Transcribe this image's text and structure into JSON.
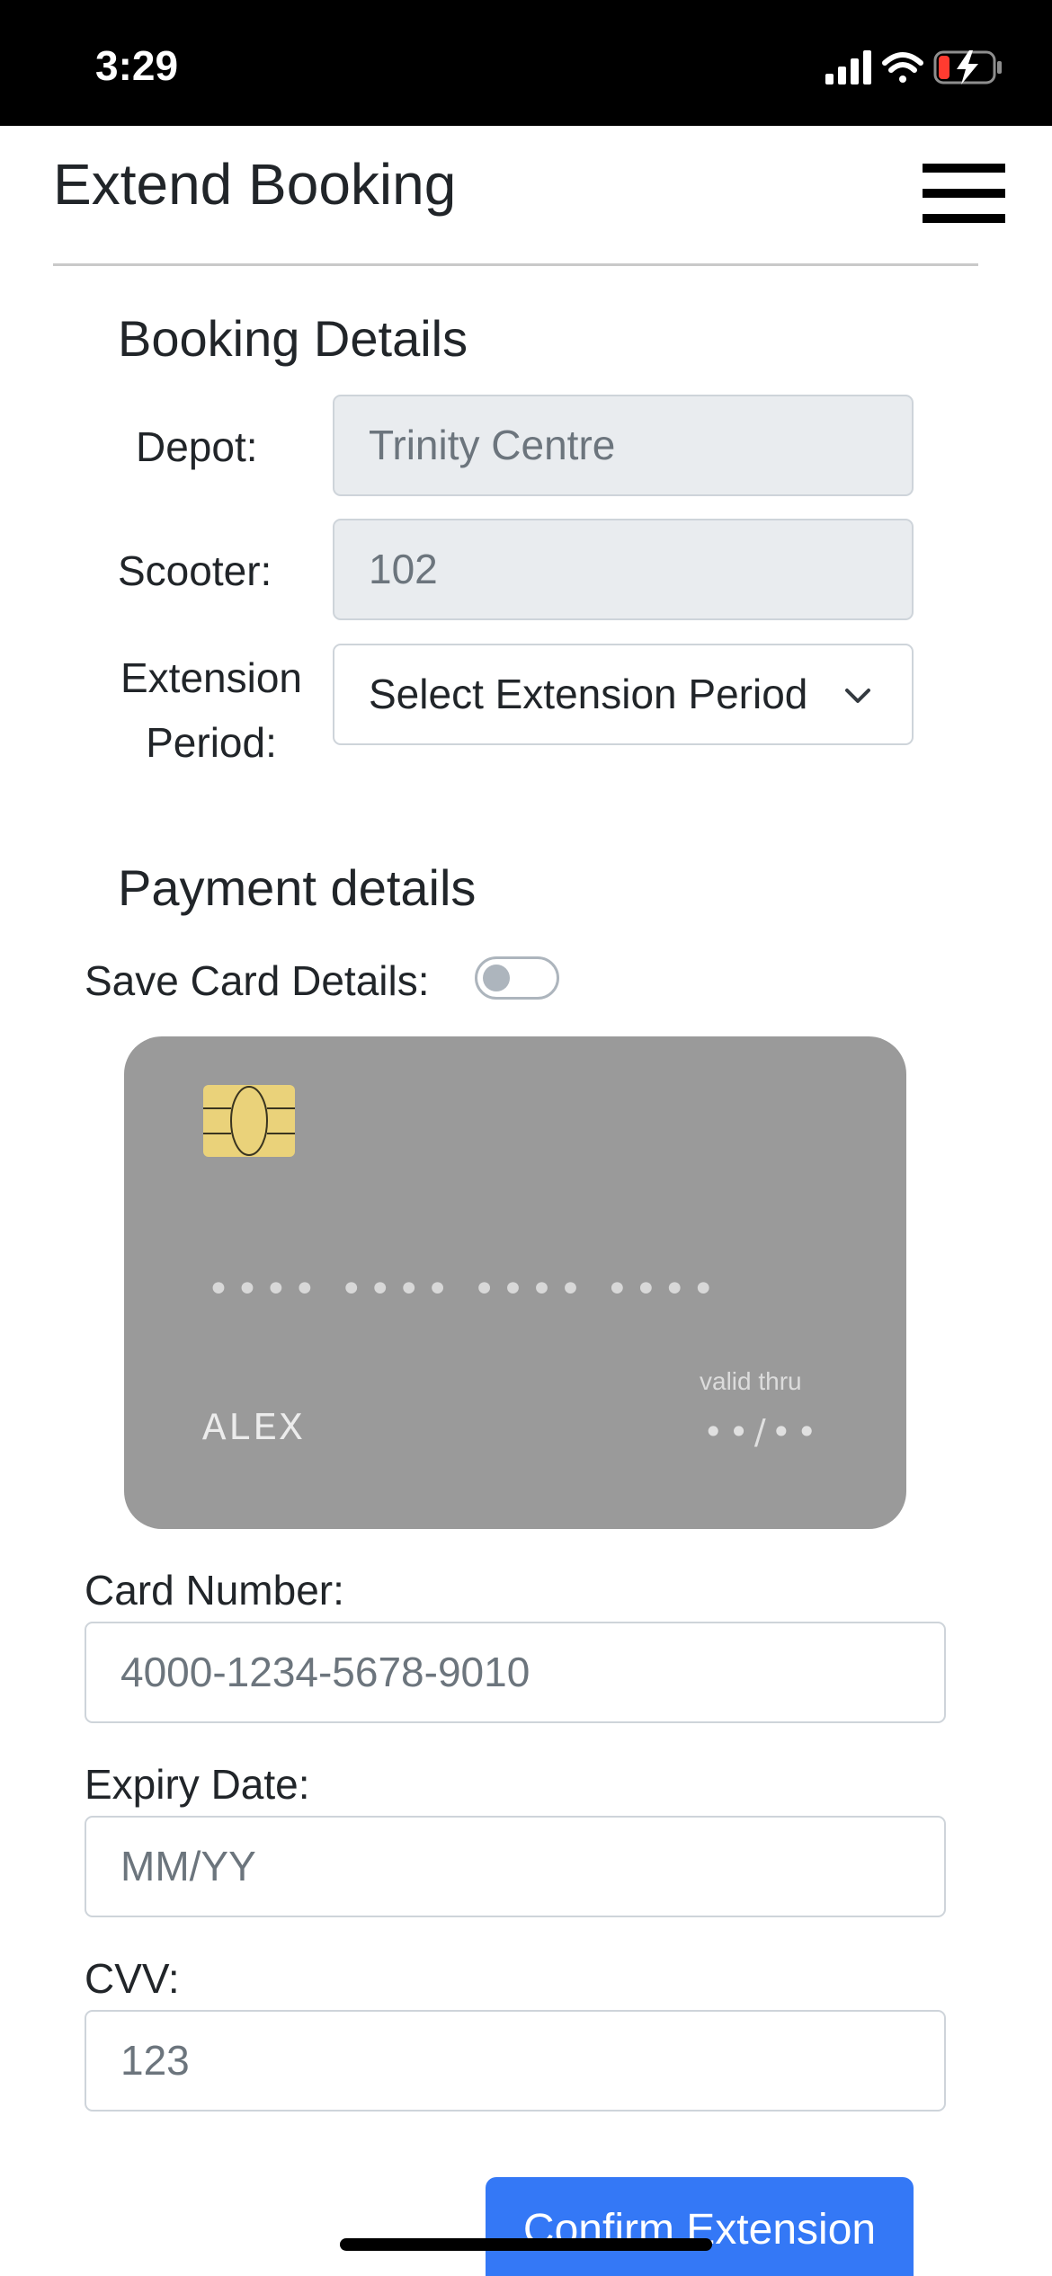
{
  "status_bar": {
    "time": "3:29"
  },
  "header": {
    "title": "Extend Booking",
    "menu_icon": "hamburger-menu-icon"
  },
  "booking_details": {
    "title": "Booking Details",
    "depot_label": "Depot:",
    "depot_value": "Trinity Centre",
    "scooter_label": "Scooter:",
    "scooter_value": "102",
    "extension_label_line1": "Extension",
    "extension_label_line2": "Period:",
    "extension_select_value": "Select Extension Period"
  },
  "payment_details": {
    "title": "Payment details",
    "save_card_label": "Save Card Details:",
    "save_card_toggle_on": false,
    "card_preview": {
      "number_mask": "•••• •••• •••• ••••",
      "name": "ALEX",
      "valid_thru_label": "valid thru",
      "expiry_mask": "••/••",
      "background_color": "#9a9a9a",
      "chip_color": "#ead27a"
    },
    "card_number_label": "Card Number:",
    "card_number_placeholder": "4000-1234-5678-9010",
    "expiry_label": "Expiry Date:",
    "expiry_placeholder": "MM/YY",
    "cvv_label": "CVV:",
    "cvv_placeholder": "123"
  },
  "actions": {
    "confirm_label": "Confirm Extension",
    "confirm_color": "#3478f6"
  }
}
